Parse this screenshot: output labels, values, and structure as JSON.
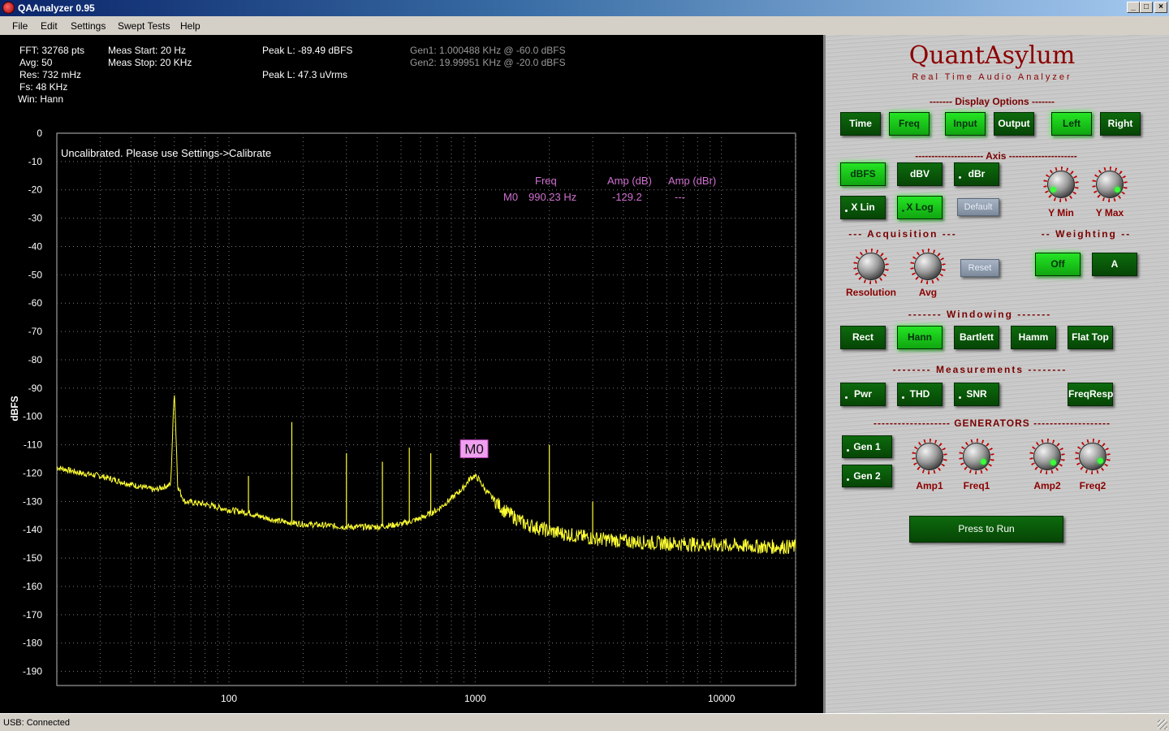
{
  "window": {
    "title": "QAAnalyzer 0.95"
  },
  "menu": [
    "File",
    "Edit",
    "Settings",
    "Swept Tests",
    "Help"
  ],
  "info": {
    "fft": "FFT: 32768 pts",
    "avg": "Avg: 50",
    "res": "Res: 732 mHz",
    "fs": "Fs: 48 KHz",
    "win": "Win: Hann",
    "meas_start": "Meas Start: 20 Hz",
    "meas_stop": "Meas Stop: 20 KHz",
    "peak_l_dbfs": "Peak L: -89.49 dBFS",
    "peak_l_uvrms": "Peak L: 47.3 uVrms",
    "gen1": "Gen1: 1.000488 KHz @ -60.0 dBFS",
    "gen2": "Gen2: 19.99951 KHz @ -20.0 dBFS"
  },
  "plot": {
    "banner": "Uncalibrated. Please use Settings->Calibrate",
    "marker_headers": {
      "freq": "Freq",
      "amp_db": "Amp (dB)",
      "amp_dbr": "Amp (dBr)"
    },
    "marker_row": {
      "id": "M0",
      "freq": "990.23 Hz",
      "amp_db": "-129.2",
      "amp_dbr": "---"
    },
    "marker_label": "M0"
  },
  "chart_data": {
    "type": "line",
    "title": "",
    "xlabel": "",
    "ylabel": "dBFS",
    "xscale": "log",
    "xlim": [
      20,
      20000
    ],
    "ylim": [
      -195,
      0
    ],
    "y_ticks": [
      0,
      -10,
      -20,
      -30,
      -40,
      -50,
      -60,
      -70,
      -80,
      -90,
      -100,
      -110,
      -120,
      -130,
      -140,
      -150,
      -160,
      -170,
      -180,
      -190
    ],
    "x_ticks": [
      100,
      1000,
      10000
    ],
    "grid": true,
    "color": "#ffff33",
    "series": [
      {
        "x": [
          20,
          25,
          30,
          40,
          50,
          58,
          60,
          62,
          66,
          80,
          100,
          120,
          130,
          160,
          180,
          200,
          250,
          300,
          400,
          500,
          600,
          700,
          800,
          900,
          950,
          990,
          1030,
          1100,
          1300,
          1600,
          2000,
          2500,
          3000,
          4000,
          5000,
          7000,
          10000,
          15000,
          20000
        ],
        "y": [
          -118,
          -120,
          -121,
          -124,
          -126,
          -124,
          -90,
          -125,
          -130,
          -131,
          -133,
          -134,
          -135,
          -137,
          -137.5,
          -138,
          -138.5,
          -139,
          -139,
          -138,
          -136,
          -133,
          -129,
          -125,
          -122,
          -121,
          -122,
          -126,
          -133,
          -138,
          -140.5,
          -142,
          -143,
          -144,
          -144.5,
          -145,
          -145.5,
          -146,
          -146
        ]
      }
    ],
    "spikes": [
      {
        "x": 60,
        "y": -90
      },
      {
        "x": 120,
        "y": -121
      },
      {
        "x": 180,
        "y": -102
      },
      {
        "x": 300,
        "y": -113
      },
      {
        "x": 420,
        "y": -116
      },
      {
        "x": 540,
        "y": -111
      },
      {
        "x": 660,
        "y": -113
      },
      {
        "x": 2000,
        "y": -110
      },
      {
        "x": 3000,
        "y": -130
      }
    ],
    "markers": [
      {
        "label": "M0",
        "x": 990.23,
        "y": -129.2
      }
    ]
  },
  "panel": {
    "brand": "QuantAsylum",
    "subtitle": "Real Time Audio Analyzer",
    "display_options": {
      "title": "------- Display Options -------",
      "buttons": [
        "Time",
        "Freq",
        "Input",
        "Output",
        "Left",
        "Right"
      ],
      "on": [
        false,
        true,
        true,
        false,
        true,
        false
      ]
    },
    "axis": {
      "title": "--------------------- Axis ---------------------",
      "buttons": [
        "dBFS",
        "dBV",
        "dBr",
        "X Lin",
        "X Log",
        "Default"
      ],
      "knobs": [
        "Y Min",
        "Y Max"
      ]
    },
    "acquisition": {
      "title": "--- Acquisition ---",
      "knobs": [
        "Resolution",
        "Avg"
      ],
      "reset": "Reset"
    },
    "weighting": {
      "title": "-- Weighting --",
      "buttons": [
        "Off",
        "A"
      ]
    },
    "windowing": {
      "title": "-------  Windowing  -------",
      "buttons": [
        "Rect",
        "Hann",
        "Bartlett",
        "Hamm",
        "Flat Top"
      ]
    },
    "measurements": {
      "title": "-------- Measurements --------",
      "buttons": [
        "Pwr",
        "THD",
        "SNR",
        "FreqResp"
      ]
    },
    "generators": {
      "title": "------------------- GENERATORS -------------------",
      "buttons": [
        "Gen 1",
        "Gen 2"
      ],
      "knobs": [
        "Amp1",
        "Freq1",
        "Amp2",
        "Freq2"
      ]
    },
    "run": "Press to Run"
  },
  "status": {
    "text": "USB: Connected"
  }
}
